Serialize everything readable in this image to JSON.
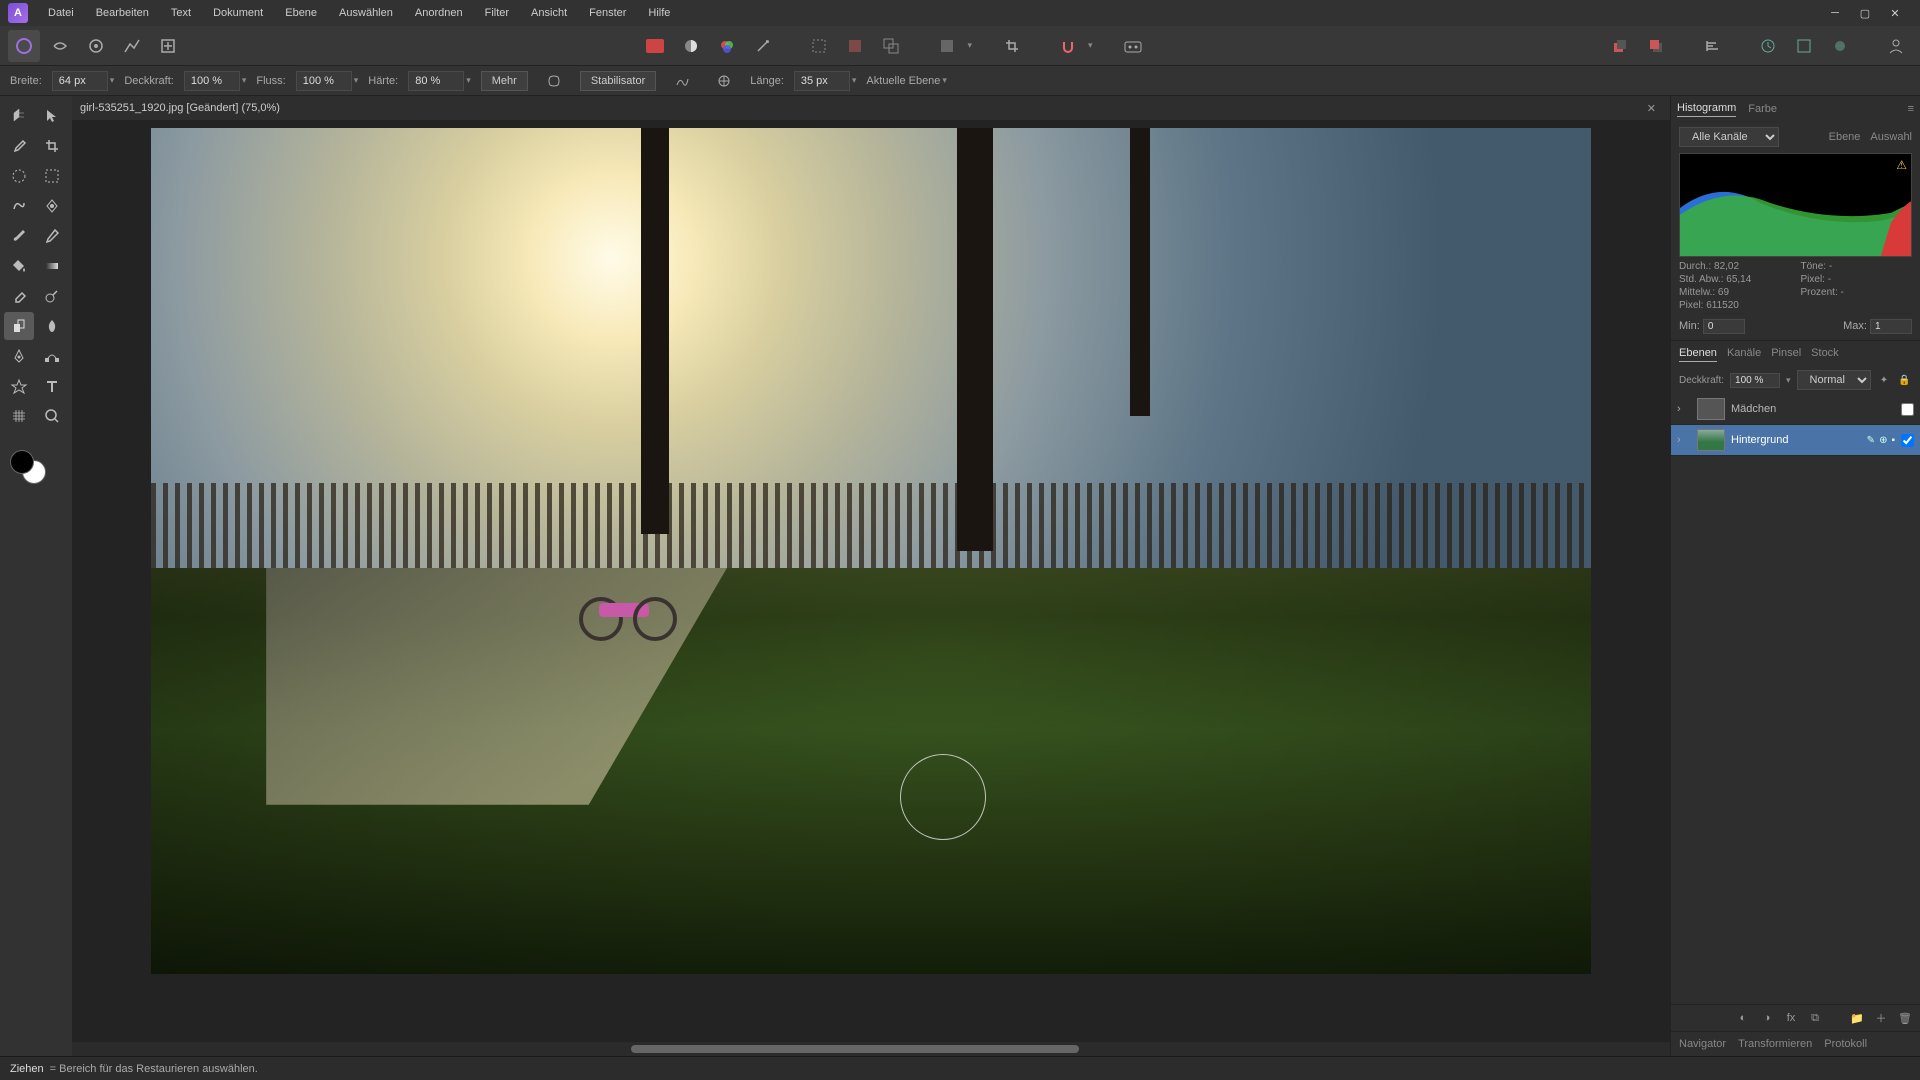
{
  "menu": {
    "items": [
      "Datei",
      "Bearbeiten",
      "Text",
      "Dokument",
      "Ebene",
      "Auswählen",
      "Anordnen",
      "Filter",
      "Ansicht",
      "Fenster",
      "Hilfe"
    ]
  },
  "context": {
    "width_label": "Breite:",
    "width_value": "64 px",
    "opacity_label": "Deckkraft:",
    "opacity_value": "100 %",
    "flow_label": "Fluss:",
    "flow_value": "100 %",
    "hardness_label": "Härte:",
    "hardness_value": "80 %",
    "more": "Mehr",
    "stabilizer": "Stabilisator",
    "length_label": "Länge:",
    "length_value": "35 px",
    "current_layer": "Aktuelle Ebene"
  },
  "document": {
    "tab": "girl-535251_1920.jpg [Geändert] (75,0%)"
  },
  "panels": {
    "histogram_tab": "Histogramm",
    "color_tab": "Farbe",
    "channels_dd": "Alle Kanäle",
    "ebene_tab": "Ebene",
    "auswahl_tab": "Auswahl",
    "stats": {
      "durch": "Durch.: 82,02",
      "tone": "Töne: -",
      "stdabw": "Std. Abw.: 65,14",
      "pixel2": "Pixel: -",
      "mittelw": "Mittelw.: 69",
      "prozent": "Prozent: -",
      "pixel": "Pixel: 611520"
    },
    "min_label": "Min:",
    "min_value": "0",
    "max_label": "Max:",
    "max_value": "1"
  },
  "layers": {
    "tabs": {
      "ebenen": "Ebenen",
      "kanale": "Kanäle",
      "pinsel": "Pinsel",
      "stock": "Stock"
    },
    "opacity_label": "Deckkraft:",
    "opacity_value": "100 %",
    "blend": "Normal",
    "items": [
      {
        "name": "Mädchen",
        "selected": false
      },
      {
        "name": "Hintergrund",
        "selected": true
      }
    ]
  },
  "bottom_tabs": {
    "navigator": "Navigator",
    "transform": "Transformieren",
    "protokoll": "Protokoll"
  },
  "status": {
    "key": "Ziehen",
    "hint": " = Bereich für das Restaurieren auswählen."
  }
}
